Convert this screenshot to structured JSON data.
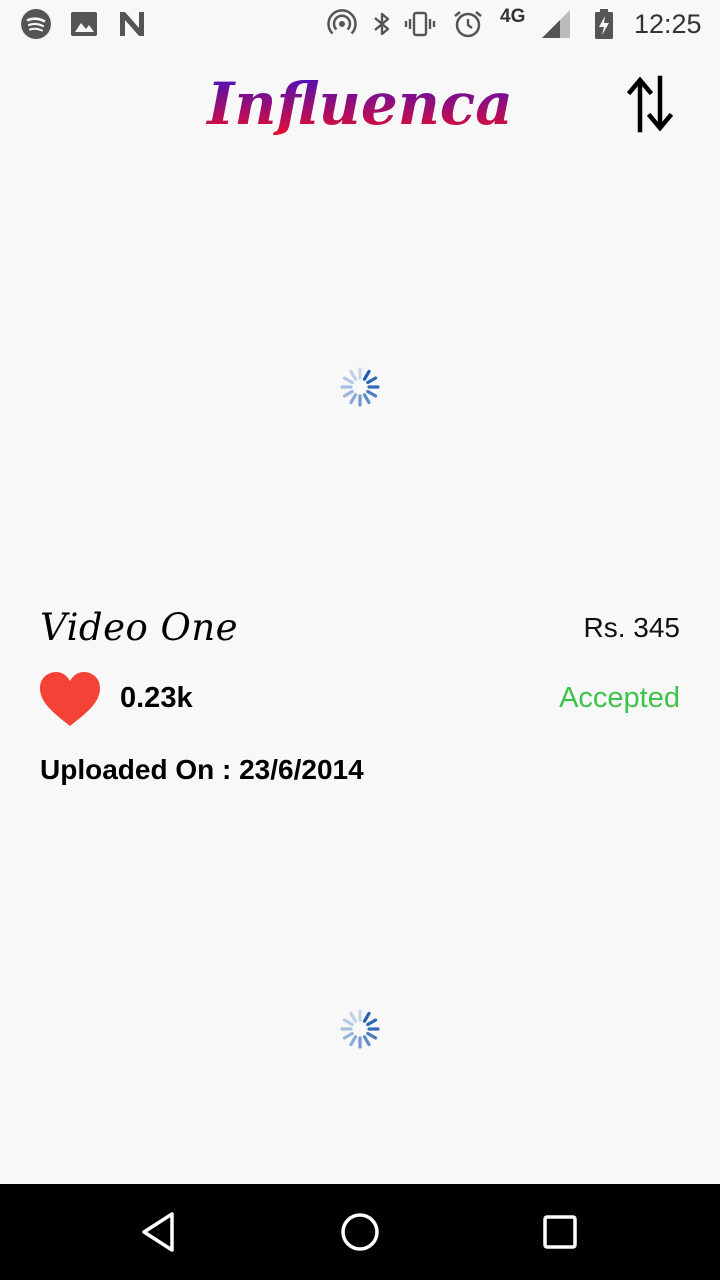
{
  "status_bar": {
    "time": "12:25",
    "network": "4G",
    "left_icons": [
      "spotify-icon",
      "image-icon",
      "n-icon"
    ],
    "right_icons": [
      "hotspot-icon",
      "bluetooth-icon",
      "vibrate-icon",
      "alarm-icon",
      "signal-icon",
      "battery-icon"
    ]
  },
  "header": {
    "logo_text": "Influenca",
    "sort_icon": "swap-vertical-icon"
  },
  "card": {
    "title": "Video One",
    "price": "Rs. 345",
    "likes": "0.23k",
    "status": "Accepted",
    "uploaded": "Uploaded On : 23/6/2014"
  },
  "colors": {
    "logo_gradient_start": "#3a10c8",
    "logo_gradient_end": "#ee0d2a",
    "heart": "#f44336",
    "accepted": "#3dc44a",
    "spinner": "#1e5fb4",
    "background": "#f8f8f8"
  },
  "nav": {
    "back": "back-triangle-icon",
    "home": "home-circle-icon",
    "recents": "recents-square-icon"
  }
}
